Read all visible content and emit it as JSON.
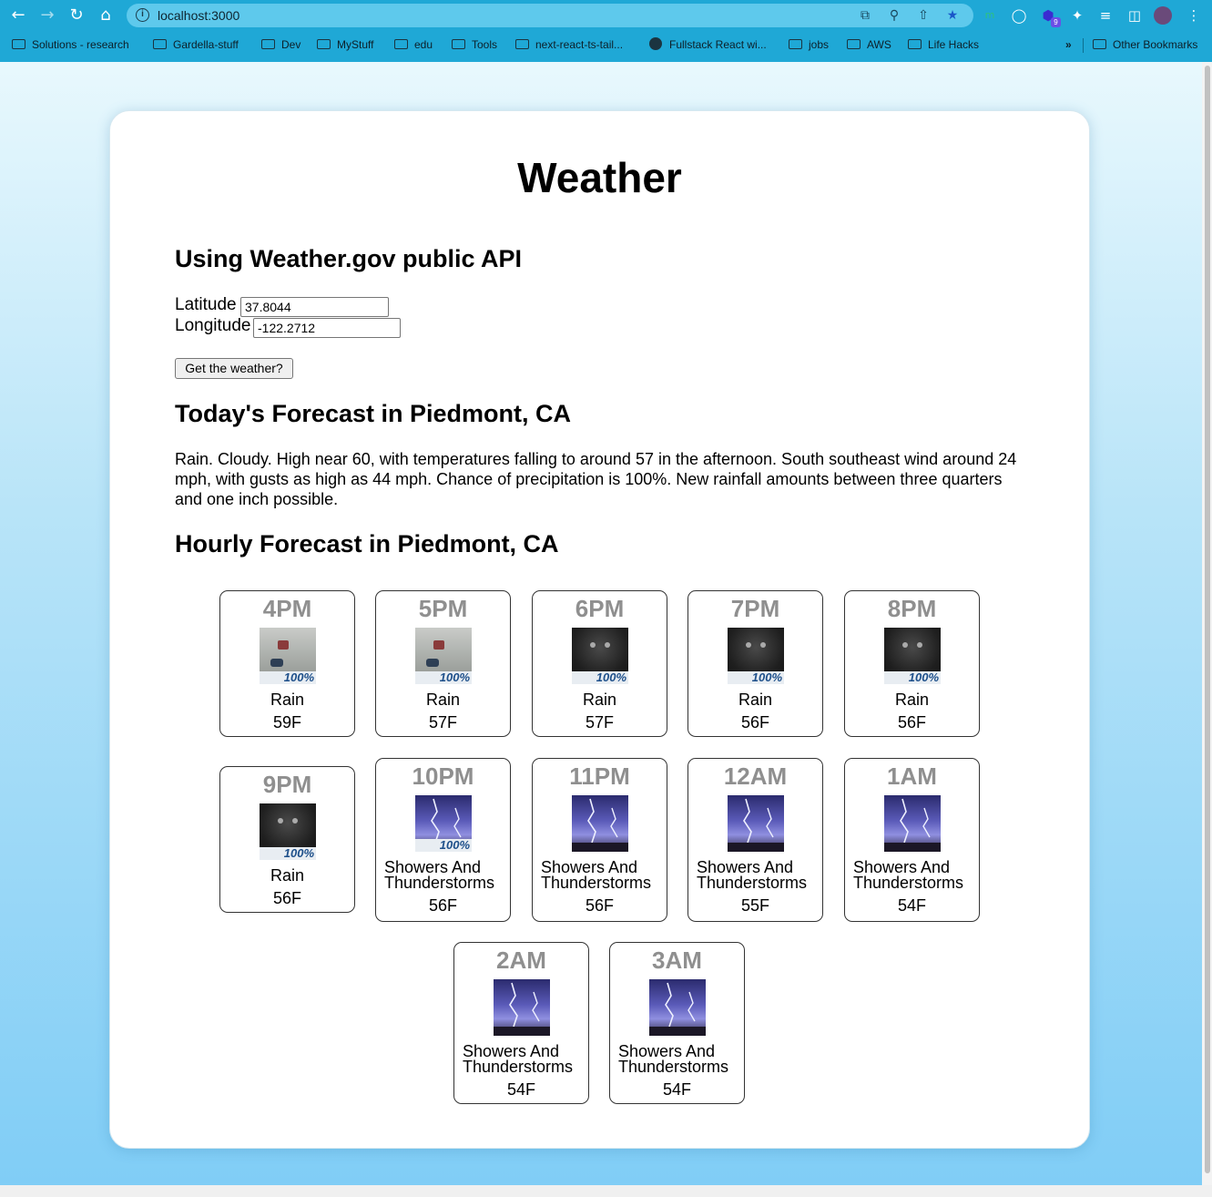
{
  "browser": {
    "url": "localhost:3000",
    "extension_badge": "9",
    "bookmarks": [
      {
        "label": "Solutions - research",
        "icon": "folder-icon"
      },
      {
        "label": "Gardella-stuff",
        "icon": "folder-icon"
      },
      {
        "label": "Dev",
        "icon": "folder-icon"
      },
      {
        "label": "MyStuff",
        "icon": "folder-icon"
      },
      {
        "label": "edu",
        "icon": "folder-icon"
      },
      {
        "label": "Tools",
        "icon": "folder-icon"
      },
      {
        "label": "next-react-ts-tail...",
        "icon": "folder-icon"
      },
      {
        "label": "Fullstack React wi...",
        "icon": "globe-icon"
      },
      {
        "label": "jobs",
        "icon": "folder-icon"
      },
      {
        "label": "AWS",
        "icon": "folder-icon"
      },
      {
        "label": "Life Hacks",
        "icon": "folder-icon"
      }
    ],
    "more_bookmarks": "»",
    "other_bookmarks": "Other Bookmarks"
  },
  "page": {
    "title": "Weather",
    "api_heading": "Using Weather.gov public API",
    "latitude_label": "Latitude",
    "latitude_value": "37.8044",
    "longitude_label": "Longitude",
    "longitude_value": "-122.2712",
    "submit_label": "Get the weather?",
    "today_heading": "Today's Forecast in Piedmont, CA",
    "today_text": "Rain. Cloudy. High near 60, with temperatures falling to around 57 in the afternoon. South southeast wind around 24 mph, with gusts as high as 44 mph. Chance of precipitation is 100%. New rainfall amounts between three quarters and one inch possible.",
    "hourly_heading": "Hourly Forecast in Piedmont, CA"
  },
  "hourly": [
    {
      "time": "4PM",
      "condition": "Rain",
      "temp": "59F",
      "image": "rain-day",
      "precip": "100%"
    },
    {
      "time": "5PM",
      "condition": "Rain",
      "temp": "57F",
      "image": "rain-day",
      "precip": "100%"
    },
    {
      "time": "6PM",
      "condition": "Rain",
      "temp": "57F",
      "image": "rain-night",
      "precip": "100%"
    },
    {
      "time": "7PM",
      "condition": "Rain",
      "temp": "56F",
      "image": "rain-night",
      "precip": "100%"
    },
    {
      "time": "8PM",
      "condition": "Rain",
      "temp": "56F",
      "image": "rain-night",
      "precip": "100%"
    },
    {
      "time": "9PM",
      "condition": "Rain",
      "temp": "56F",
      "image": "rain-night",
      "precip": "100%"
    },
    {
      "time": "10PM",
      "condition": "Showers And Thunderstorms",
      "temp": "56F",
      "image": "thunderstorm",
      "precip": "100%"
    },
    {
      "time": "11PM",
      "condition": "Showers And Thunderstorms",
      "temp": "56F",
      "image": "thunderstorm",
      "precip": ""
    },
    {
      "time": "12AM",
      "condition": "Showers And Thunderstorms",
      "temp": "55F",
      "image": "thunderstorm",
      "precip": ""
    },
    {
      "time": "1AM",
      "condition": "Showers And Thunderstorms",
      "temp": "54F",
      "image": "thunderstorm",
      "precip": ""
    },
    {
      "time": "2AM",
      "condition": "Showers And Thunderstorms",
      "temp": "54F",
      "image": "thunderstorm",
      "precip": ""
    },
    {
      "time": "3AM",
      "condition": "Showers And Thunderstorms",
      "temp": "54F",
      "image": "thunderstorm",
      "precip": ""
    }
  ],
  "colors": {
    "chrome": "#1fa8d6",
    "time_label": "#8f8f8f",
    "page_gradient_top": "#e8f8fd",
    "page_gradient_bottom": "#80cdf6"
  }
}
